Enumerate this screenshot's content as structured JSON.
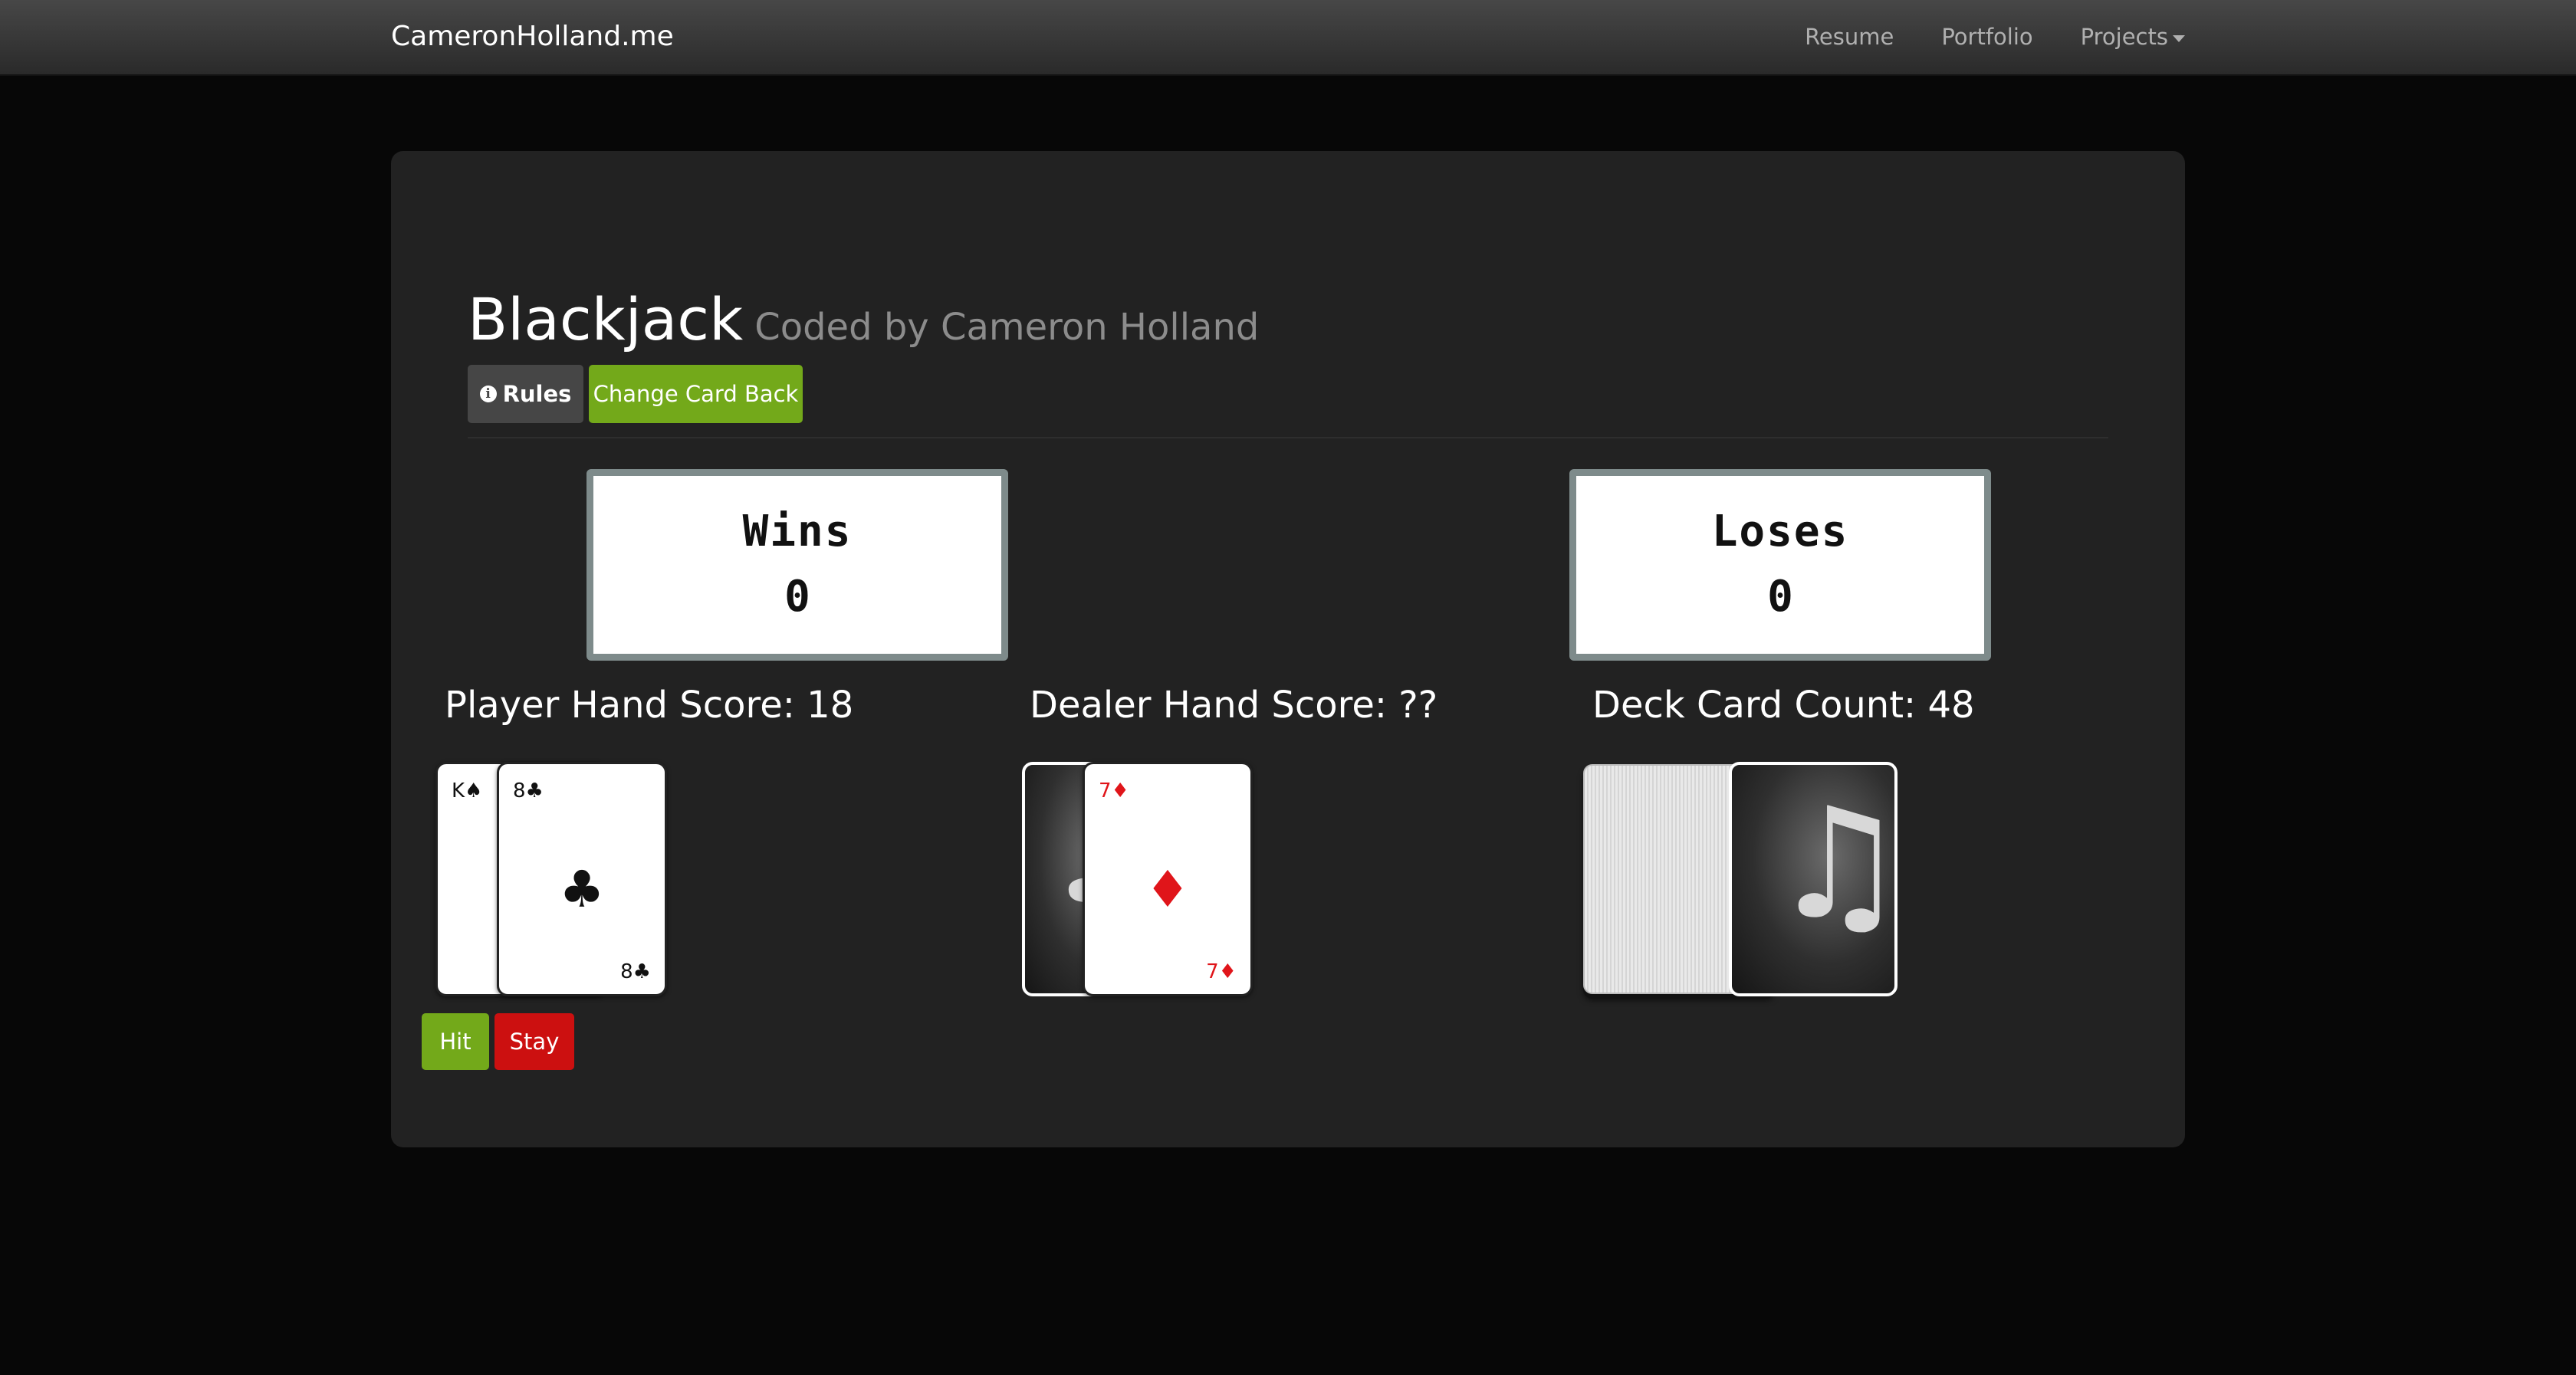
{
  "navbar": {
    "brand": "CameronHolland.me",
    "links": [
      "Resume",
      "Portfolio",
      "Projects"
    ]
  },
  "header": {
    "title": "Blackjack",
    "subtitle": "Coded by Cameron Holland",
    "rules_button": "Rules",
    "change_back_button": "Change Card Back"
  },
  "scores": {
    "wins_label": "Wins",
    "wins_value": "0",
    "loses_label": "Loses",
    "loses_value": "0"
  },
  "player": {
    "label": "Player Hand Score: 18",
    "cards": [
      {
        "rank_suit": "K♠"
      },
      {
        "rank_suit": "8♣",
        "suit": "♣"
      }
    ],
    "hit_button": "Hit",
    "stay_button": "Stay"
  },
  "dealer": {
    "label": "Dealer Hand Score: ??",
    "cards": [
      {
        "face_down": true,
        "back_icon": "music-note-icon"
      },
      {
        "rank_suit": "7♦",
        "suit": "♦"
      }
    ]
  },
  "deck": {
    "label": "Deck Card Count: 48",
    "back_icon": "music-note-icon"
  },
  "colors": {
    "accent_green": "#73a91a",
    "danger_red": "#cc1010",
    "panel": "#222222",
    "background": "#070707"
  }
}
